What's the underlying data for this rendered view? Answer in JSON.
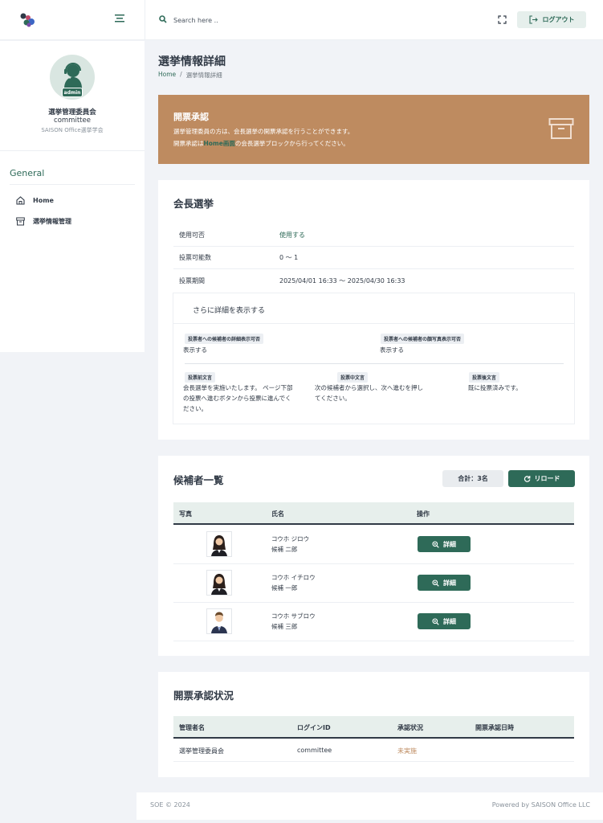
{
  "header": {
    "search_placeholder": "Search here ..",
    "logout_label": "ログアウト"
  },
  "user": {
    "role_badge": "admin",
    "name": "選挙管理委員会",
    "id": "committee",
    "org": "SAISON Office選挙学会"
  },
  "nav": {
    "section": "General",
    "items": [
      {
        "label": "Home",
        "icon": "home-icon"
      },
      {
        "label": "選挙情報管理",
        "icon": "archive-icon"
      }
    ]
  },
  "page": {
    "title": "選挙情報詳細",
    "breadcrumb": {
      "home": "Home",
      "sep": "/",
      "current": "選挙情報詳細"
    }
  },
  "alert": {
    "title": "開票承認",
    "line1": "選挙管理委員の方は、会長選挙の開票承認を行うことができます。",
    "line2_pre": "開票承認は",
    "line2_link": "Home画面",
    "line2_post": "の会長選挙ブロックから行ってください。"
  },
  "election": {
    "title": "会長選挙",
    "rows": [
      {
        "label": "使用可否",
        "value": "使用する"
      },
      {
        "label": "投票可能数",
        "value": "0 〜 1"
      },
      {
        "label": "投票期間",
        "value": "2025/04/01 16:33 〜 2025/04/30 16:33"
      }
    ],
    "details": {
      "toggle_label": "さらに詳細を表示する",
      "fields": [
        {
          "label": "投票者への候補者の詳細表示可否",
          "value": "表示する"
        },
        {
          "label": "投票者への候補者の顔写真表示可否",
          "value": "表示する"
        },
        {
          "label": "投票前文言",
          "lines": [
            "会長選挙を実施いたします。 ページ下部",
            "の投票へ進むボタンから投票に進んでく",
            "ださい。"
          ]
        },
        {
          "label": "投票中文言",
          "lines": [
            "次の候補者から選択し、次へ進むを押し",
            "てください。"
          ]
        },
        {
          "label": "投票後文言",
          "lines": [
            "既に投票済みです。"
          ]
        }
      ]
    }
  },
  "candidates": {
    "title": "候補者一覧",
    "total": "合計：3名",
    "reload_label": "リロード",
    "columns": [
      "写真",
      "氏名",
      "操作"
    ],
    "rows": [
      {
        "kana": "コウホ ジロウ",
        "name": "候補 二郎",
        "gender": "female",
        "action": "詳細"
      },
      {
        "kana": "コウホ イチロウ",
        "name": "候補 一郎",
        "gender": "female",
        "action": "詳細"
      },
      {
        "kana": "コウホ サブロウ",
        "name": "候補 三郎",
        "gender": "male",
        "action": "詳細"
      }
    ]
  },
  "approval": {
    "title": "開票承認状況",
    "columns": [
      "管理者名",
      "ログインID",
      "承認状況",
      "開票承認日時"
    ],
    "rows": [
      {
        "admin": "選挙管理委員会",
        "login_id": "committee",
        "status": "未実施",
        "datetime": ""
      }
    ]
  },
  "footer": {
    "left": "SOE © 2024",
    "right": "Powered by SAISON Office LLC"
  },
  "colors": {
    "primary": "#2e6a58",
    "alert": "#be8b60",
    "background": "#f1f3f7"
  }
}
